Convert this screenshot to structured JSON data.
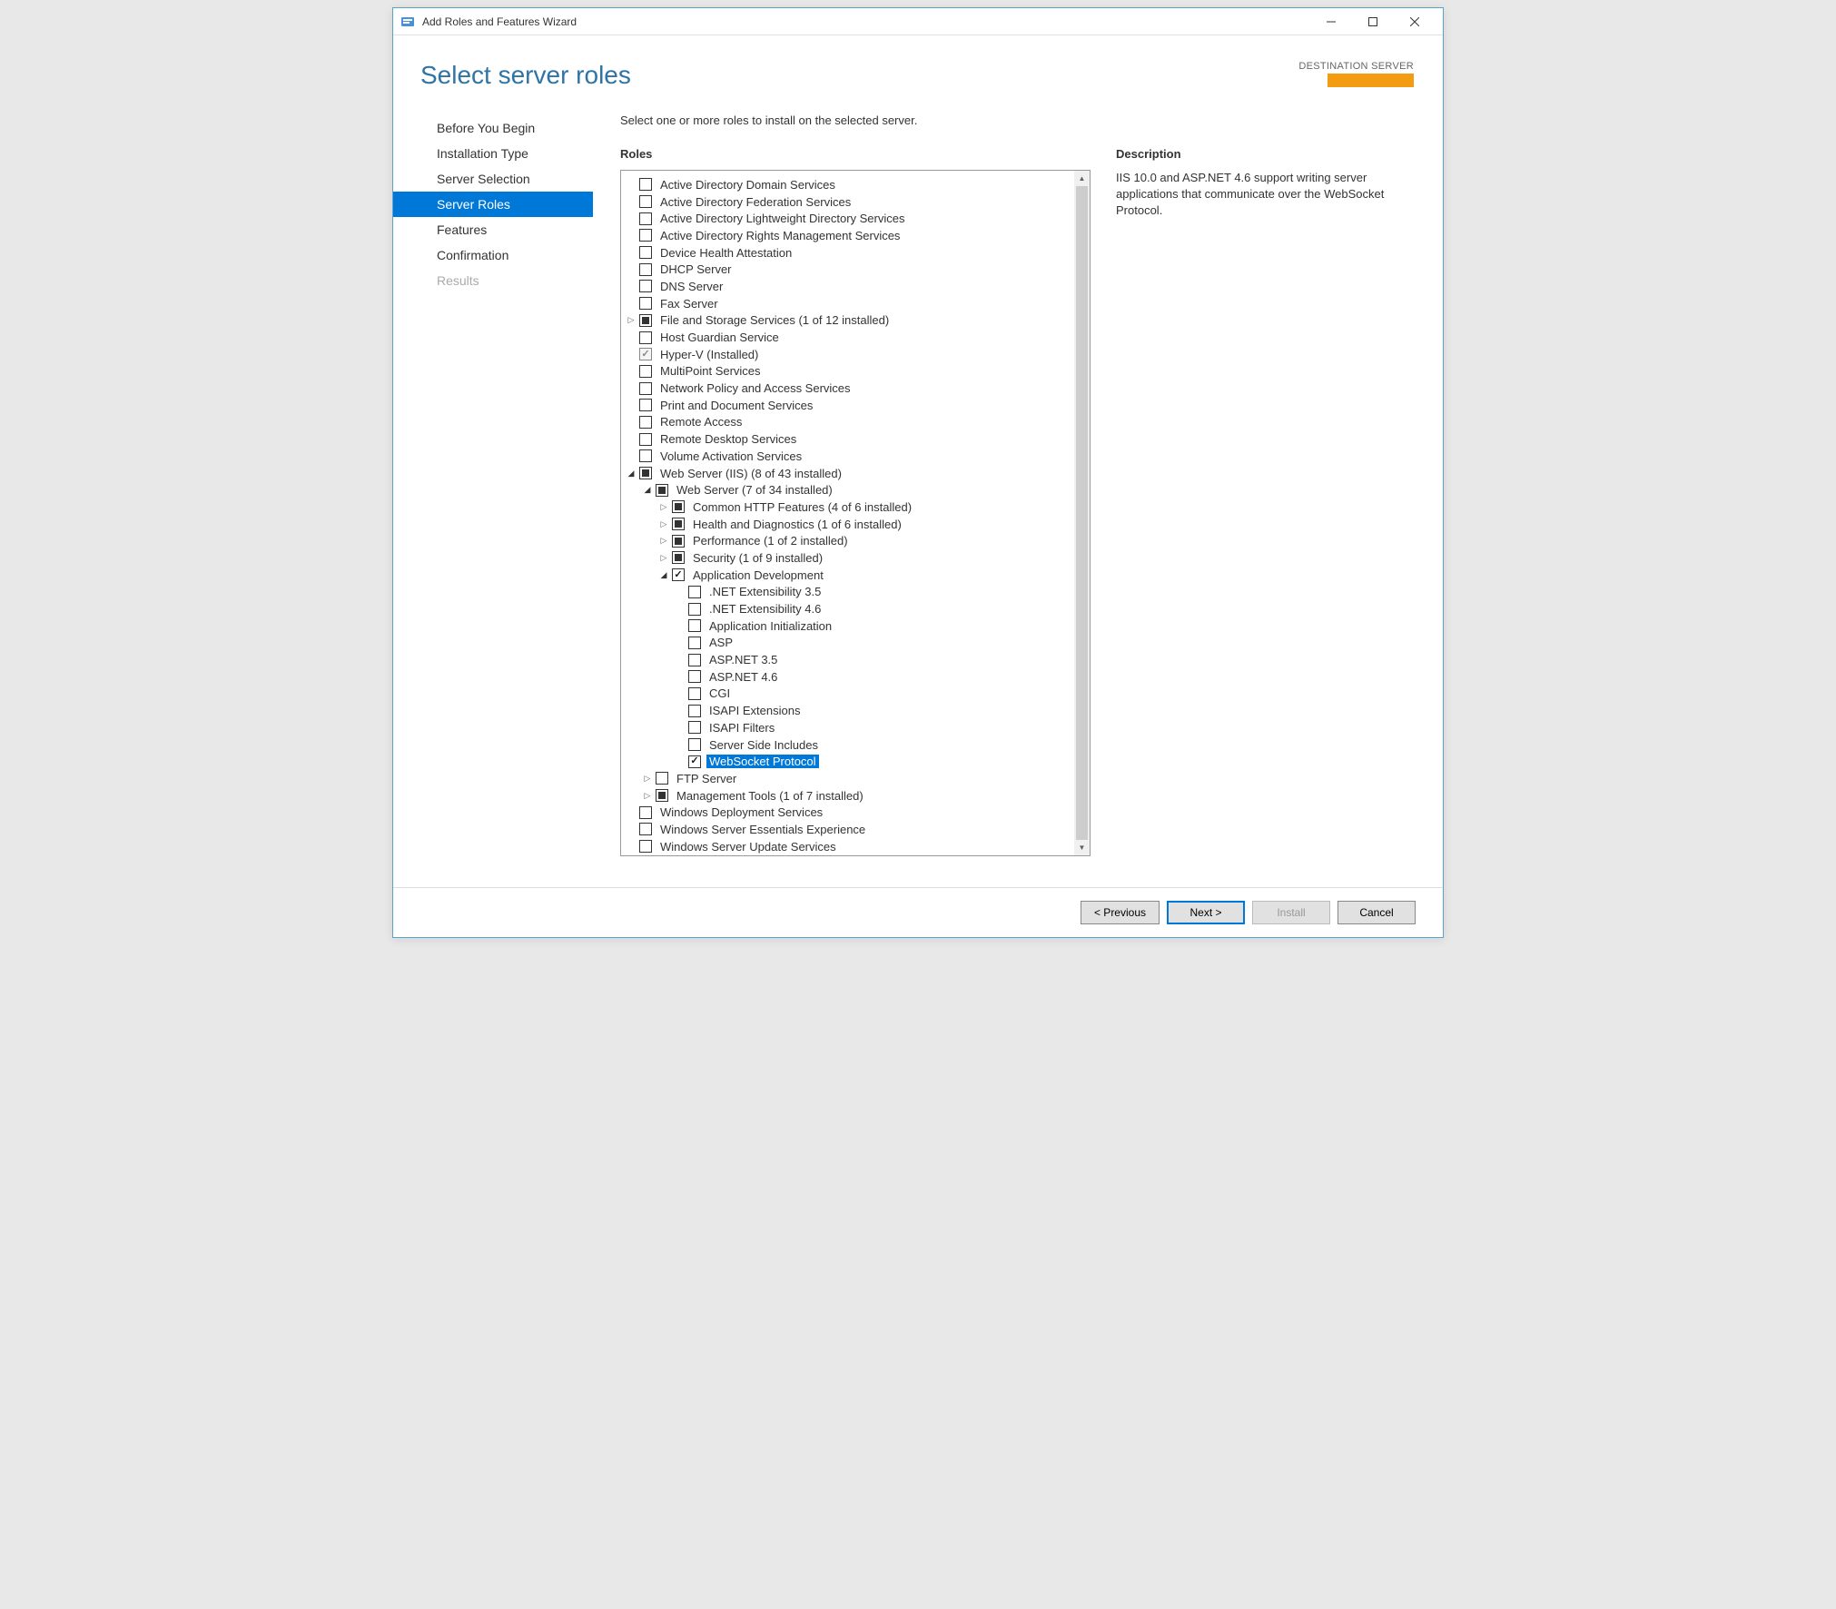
{
  "window": {
    "title": "Add Roles and Features Wizard"
  },
  "header": {
    "page_title": "Select server roles",
    "destination_label": "DESTINATION SERVER"
  },
  "sidebar": {
    "items": [
      {
        "label": "Before You Begin"
      },
      {
        "label": "Installation Type"
      },
      {
        "label": "Server Selection"
      },
      {
        "label": "Server Roles"
      },
      {
        "label": "Features"
      },
      {
        "label": "Confirmation"
      },
      {
        "label": "Results"
      }
    ]
  },
  "main": {
    "instruction": "Select one or more roles to install on the selected server.",
    "roles_label": "Roles",
    "desc_label": "Description",
    "description_text": "IIS 10.0 and ASP.NET 4.6 support writing server applications that communicate over the WebSocket Protocol.",
    "tree": [
      {
        "indent": 0,
        "expand": "",
        "check": "unchecked",
        "label": "Active Directory Domain Services",
        "sel": false
      },
      {
        "indent": 0,
        "expand": "",
        "check": "unchecked",
        "label": "Active Directory Federation Services",
        "sel": false
      },
      {
        "indent": 0,
        "expand": "",
        "check": "unchecked",
        "label": "Active Directory Lightweight Directory Services",
        "sel": false
      },
      {
        "indent": 0,
        "expand": "",
        "check": "unchecked",
        "label": "Active Directory Rights Management Services",
        "sel": false
      },
      {
        "indent": 0,
        "expand": "",
        "check": "unchecked",
        "label": "Device Health Attestation",
        "sel": false
      },
      {
        "indent": 0,
        "expand": "",
        "check": "unchecked",
        "label": "DHCP Server",
        "sel": false
      },
      {
        "indent": 0,
        "expand": "",
        "check": "unchecked",
        "label": "DNS Server",
        "sel": false
      },
      {
        "indent": 0,
        "expand": "",
        "check": "unchecked",
        "label": "Fax Server",
        "sel": false
      },
      {
        "indent": 0,
        "expand": "collapsed",
        "check": "partial",
        "label": "File and Storage Services (1 of 12 installed)",
        "sel": false
      },
      {
        "indent": 0,
        "expand": "",
        "check": "unchecked",
        "label": "Host Guardian Service",
        "sel": false
      },
      {
        "indent": 0,
        "expand": "",
        "check": "checked-disabled",
        "label": "Hyper-V (Installed)",
        "sel": false
      },
      {
        "indent": 0,
        "expand": "",
        "check": "unchecked",
        "label": "MultiPoint Services",
        "sel": false
      },
      {
        "indent": 0,
        "expand": "",
        "check": "unchecked",
        "label": "Network Policy and Access Services",
        "sel": false
      },
      {
        "indent": 0,
        "expand": "",
        "check": "unchecked",
        "label": "Print and Document Services",
        "sel": false
      },
      {
        "indent": 0,
        "expand": "",
        "check": "unchecked",
        "label": "Remote Access",
        "sel": false
      },
      {
        "indent": 0,
        "expand": "",
        "check": "unchecked",
        "label": "Remote Desktop Services",
        "sel": false
      },
      {
        "indent": 0,
        "expand": "",
        "check": "unchecked",
        "label": "Volume Activation Services",
        "sel": false
      },
      {
        "indent": 0,
        "expand": "expanded",
        "check": "partial",
        "label": "Web Server (IIS) (8 of 43 installed)",
        "sel": false
      },
      {
        "indent": 1,
        "expand": "expanded",
        "check": "partial",
        "label": "Web Server (7 of 34 installed)",
        "sel": false
      },
      {
        "indent": 2,
        "expand": "collapsed",
        "check": "partial",
        "label": "Common HTTP Features (4 of 6 installed)",
        "sel": false
      },
      {
        "indent": 2,
        "expand": "collapsed",
        "check": "partial",
        "label": "Health and Diagnostics (1 of 6 installed)",
        "sel": false
      },
      {
        "indent": 2,
        "expand": "collapsed",
        "check": "partial",
        "label": "Performance (1 of 2 installed)",
        "sel": false
      },
      {
        "indent": 2,
        "expand": "collapsed",
        "check": "partial",
        "label": "Security (1 of 9 installed)",
        "sel": false
      },
      {
        "indent": 2,
        "expand": "expanded",
        "check": "checked",
        "label": "Application Development",
        "sel": false
      },
      {
        "indent": 3,
        "expand": "",
        "check": "unchecked",
        "label": ".NET Extensibility 3.5",
        "sel": false
      },
      {
        "indent": 3,
        "expand": "",
        "check": "unchecked",
        "label": ".NET Extensibility 4.6",
        "sel": false
      },
      {
        "indent": 3,
        "expand": "",
        "check": "unchecked",
        "label": "Application Initialization",
        "sel": false
      },
      {
        "indent": 3,
        "expand": "",
        "check": "unchecked",
        "label": "ASP",
        "sel": false
      },
      {
        "indent": 3,
        "expand": "",
        "check": "unchecked",
        "label": "ASP.NET 3.5",
        "sel": false
      },
      {
        "indent": 3,
        "expand": "",
        "check": "unchecked",
        "label": "ASP.NET 4.6",
        "sel": false
      },
      {
        "indent": 3,
        "expand": "",
        "check": "unchecked",
        "label": "CGI",
        "sel": false
      },
      {
        "indent": 3,
        "expand": "",
        "check": "unchecked",
        "label": "ISAPI Extensions",
        "sel": false
      },
      {
        "indent": 3,
        "expand": "",
        "check": "unchecked",
        "label": "ISAPI Filters",
        "sel": false
      },
      {
        "indent": 3,
        "expand": "",
        "check": "unchecked",
        "label": "Server Side Includes",
        "sel": false
      },
      {
        "indent": 3,
        "expand": "",
        "check": "checked",
        "label": "WebSocket Protocol",
        "sel": true
      },
      {
        "indent": 1,
        "expand": "collapsed",
        "check": "unchecked",
        "label": "FTP Server",
        "sel": false
      },
      {
        "indent": 1,
        "expand": "collapsed",
        "check": "partial",
        "label": "Management Tools (1 of 7 installed)",
        "sel": false
      },
      {
        "indent": 0,
        "expand": "",
        "check": "unchecked",
        "label": "Windows Deployment Services",
        "sel": false
      },
      {
        "indent": 0,
        "expand": "",
        "check": "unchecked",
        "label": "Windows Server Essentials Experience",
        "sel": false
      },
      {
        "indent": 0,
        "expand": "",
        "check": "unchecked",
        "label": "Windows Server Update Services",
        "sel": false
      }
    ]
  },
  "footer": {
    "previous": "< Previous",
    "next": "Next >",
    "install": "Install",
    "cancel": "Cancel"
  }
}
